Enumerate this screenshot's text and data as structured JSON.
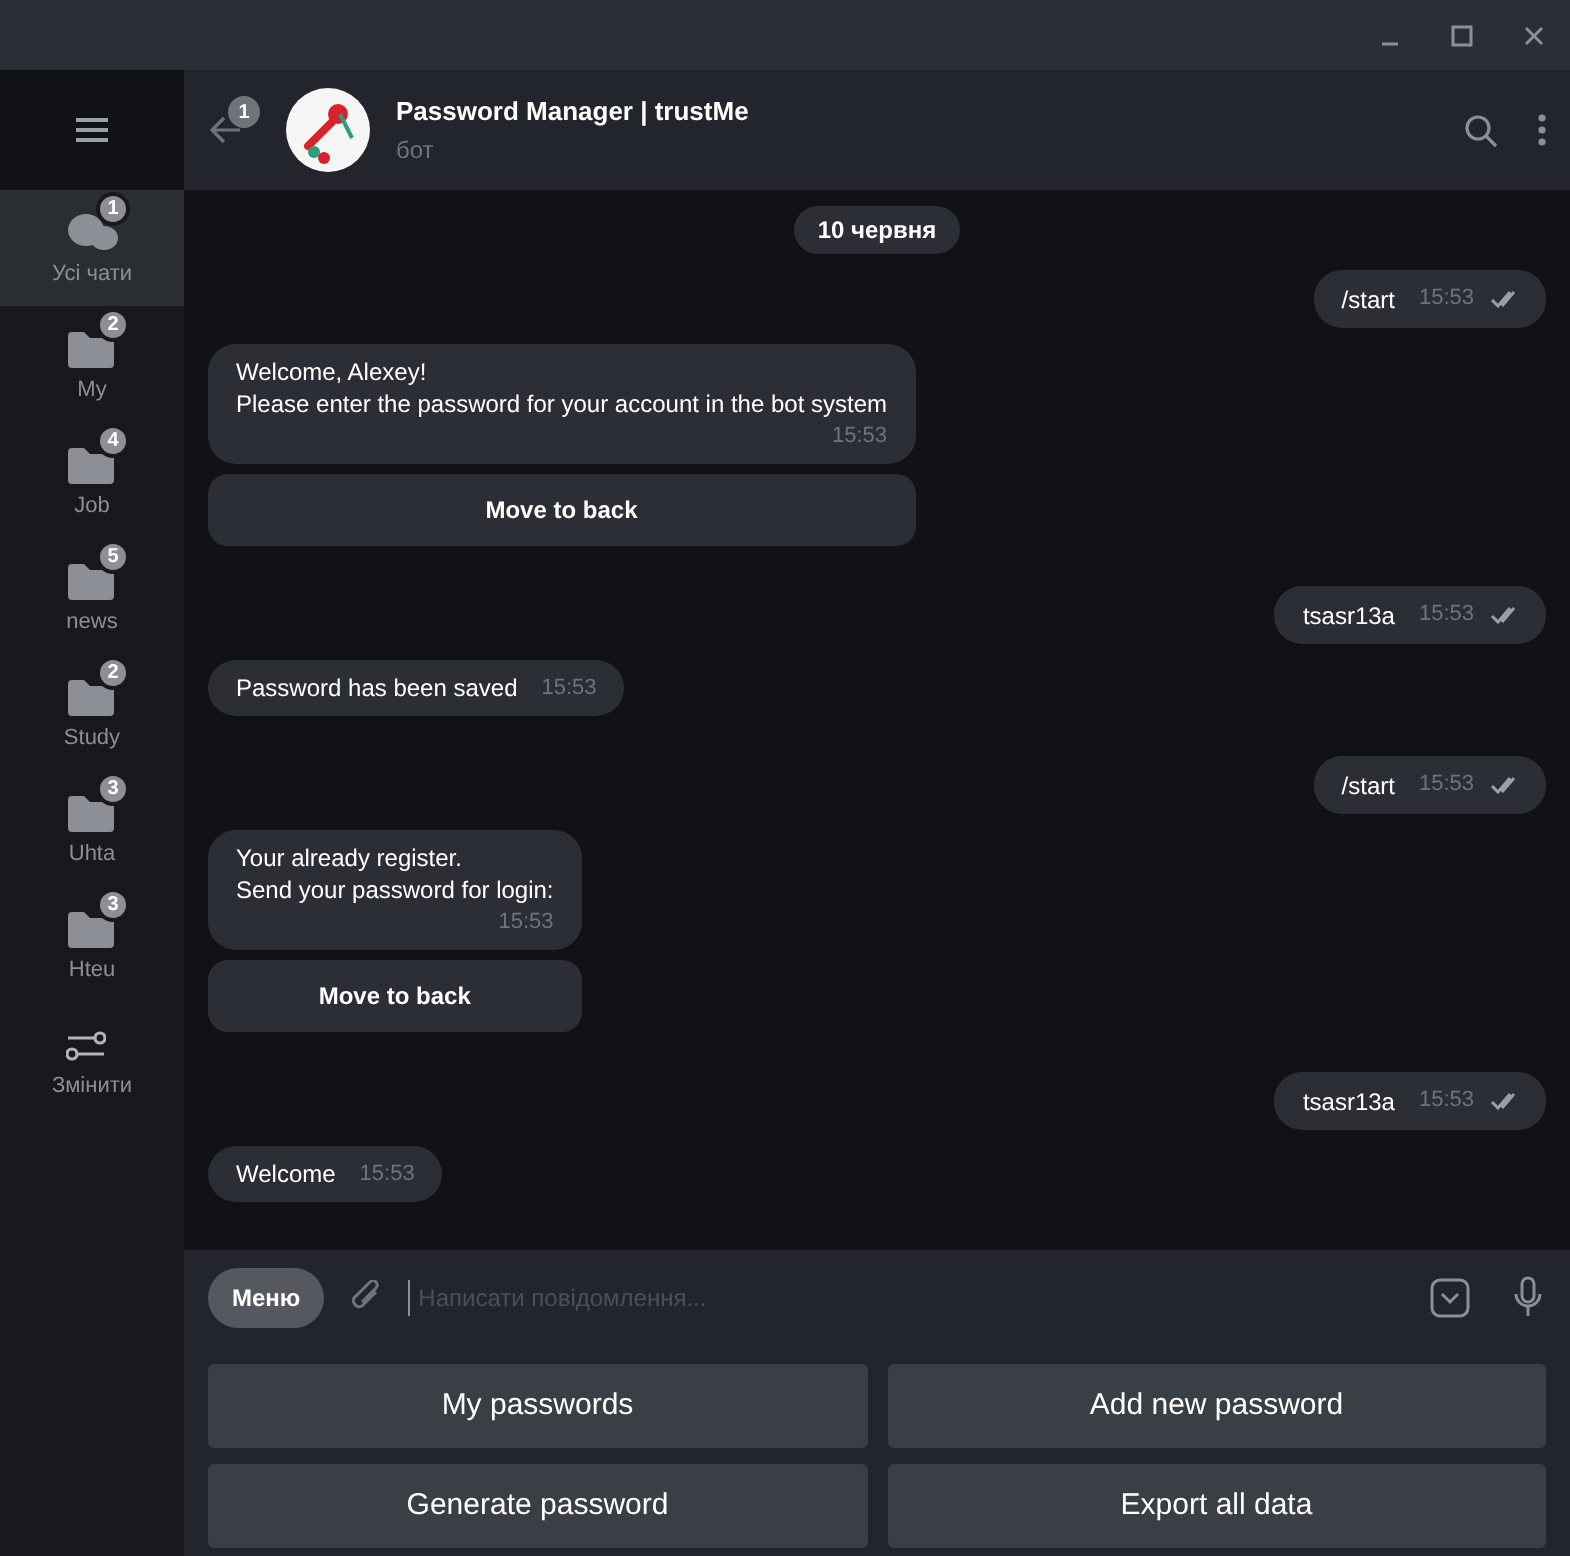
{
  "sidebar": {
    "items": [
      {
        "label": "Усі чати",
        "badge": "1",
        "kind": "chats",
        "selected": true
      },
      {
        "label": "My",
        "badge": "2",
        "kind": "folder",
        "selected": false
      },
      {
        "label": "Job",
        "badge": "4",
        "kind": "folder",
        "selected": false
      },
      {
        "label": "news",
        "badge": "5",
        "kind": "folder",
        "selected": false
      },
      {
        "label": "Study",
        "badge": "2",
        "kind": "folder",
        "selected": false
      },
      {
        "label": "Uhta",
        "badge": "3",
        "kind": "folder",
        "selected": false
      },
      {
        "label": "Hteu",
        "badge": "3",
        "kind": "folder",
        "selected": false
      },
      {
        "label": "Змінити",
        "kind": "edit",
        "selected": false
      }
    ]
  },
  "header": {
    "back_badge": "1",
    "title": "Password Manager | trustMe",
    "subtitle": "бот"
  },
  "date_separator": "10 червня",
  "messages": [
    {
      "kind": "out",
      "lines": [
        "/start"
      ],
      "time": "15:53",
      "read": true
    },
    {
      "kind": "in",
      "lines": [
        "Welcome, Alexey!",
        "Please enter the password for your account in the bot system"
      ],
      "time": "15:53",
      "buttons": [
        "Move to back"
      ]
    },
    {
      "kind": "out",
      "lines": [
        "tsasr13a"
      ],
      "time": "15:53",
      "read": true
    },
    {
      "kind": "in",
      "lines": [
        "Password has been saved"
      ],
      "time": "15:53"
    },
    {
      "kind": "out",
      "lines": [
        "/start"
      ],
      "time": "15:53",
      "read": true
    },
    {
      "kind": "in",
      "lines": [
        "Your already register.",
        "Send your password for login:"
      ],
      "time": "15:53",
      "buttons": [
        "Move to back"
      ]
    },
    {
      "kind": "out",
      "lines": [
        "tsasr13a"
      ],
      "time": "15:53",
      "read": true
    },
    {
      "kind": "in",
      "lines": [
        "Welcome"
      ],
      "time": "15:53"
    }
  ],
  "composer": {
    "menu_button": "Меню",
    "placeholder": "Написати повідомлення..."
  },
  "keyboard": [
    {
      "label": "My passwords"
    },
    {
      "label": "Add new password"
    },
    {
      "label": "Generate password"
    },
    {
      "label": "Export all data"
    }
  ]
}
